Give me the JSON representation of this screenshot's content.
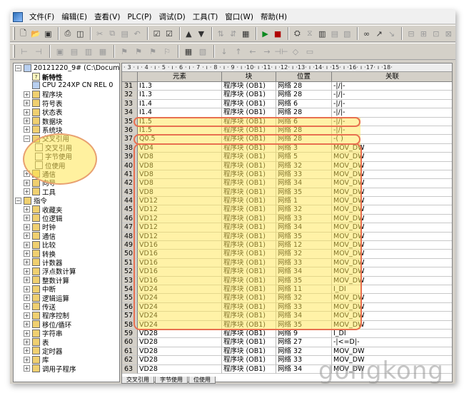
{
  "menu": [
    "文件(F)",
    "编辑(E)",
    "查看(V)",
    "PLC(P)",
    "调试(D)",
    "工具(T)",
    "窗口(W)",
    "帮助(H)"
  ],
  "tree": {
    "project": "20121220_9# (C:\\Docume",
    "items": [
      {
        "label": "新特性",
        "bold": true,
        "level": 1,
        "icon": "help"
      },
      {
        "label": "CPU 224XP CN REL 0",
        "level": 1,
        "icon": "cpu"
      },
      {
        "label": "程序块",
        "level": 1,
        "icon": "folder",
        "exp": "+"
      },
      {
        "label": "符号表",
        "level": 1,
        "icon": "folder",
        "exp": "+"
      },
      {
        "label": "状态表",
        "level": 1,
        "icon": "folder",
        "exp": "+"
      },
      {
        "label": "数据块",
        "level": 1,
        "icon": "folder",
        "exp": "+"
      },
      {
        "label": "系统块",
        "level": 1,
        "icon": "folder",
        "exp": "+"
      },
      {
        "label": "交叉引用",
        "level": 1,
        "icon": "folder",
        "exp": "-"
      },
      {
        "label": "交叉引用",
        "level": 2,
        "icon": "doc"
      },
      {
        "label": "字节使用",
        "level": 2,
        "icon": "doc"
      },
      {
        "label": "位使用",
        "level": 2,
        "icon": "doc"
      },
      {
        "label": "通信",
        "level": 1,
        "icon": "folder",
        "exp": "+"
      },
      {
        "label": "向导",
        "level": 1,
        "icon": "folder",
        "exp": "+"
      },
      {
        "label": "工具",
        "level": 1,
        "icon": "folder",
        "exp": "+"
      },
      {
        "label": "指令",
        "level": 0,
        "icon": "folder",
        "exp": "-"
      },
      {
        "label": "收藏夹",
        "level": 1,
        "icon": "folder",
        "exp": "+"
      },
      {
        "label": "位逻辑",
        "level": 1,
        "icon": "folder",
        "exp": "+"
      },
      {
        "label": "时钟",
        "level": 1,
        "icon": "folder",
        "exp": "+"
      },
      {
        "label": "通信",
        "level": 1,
        "icon": "folder",
        "exp": "+"
      },
      {
        "label": "比较",
        "level": 1,
        "icon": "folder",
        "exp": "+"
      },
      {
        "label": "转换",
        "level": 1,
        "icon": "folder",
        "exp": "+"
      },
      {
        "label": "计数器",
        "level": 1,
        "icon": "folder",
        "exp": "+"
      },
      {
        "label": "浮点数计算",
        "level": 1,
        "icon": "folder",
        "exp": "+"
      },
      {
        "label": "整数计算",
        "level": 1,
        "icon": "folder",
        "exp": "+"
      },
      {
        "label": "中断",
        "level": 1,
        "icon": "folder",
        "exp": "+"
      },
      {
        "label": "逻辑运算",
        "level": 1,
        "icon": "folder",
        "exp": "+"
      },
      {
        "label": "传送",
        "level": 1,
        "icon": "folder",
        "exp": "+"
      },
      {
        "label": "程序控制",
        "level": 1,
        "icon": "folder",
        "exp": "+"
      },
      {
        "label": "移位/循环",
        "level": 1,
        "icon": "folder",
        "exp": "+"
      },
      {
        "label": "字符串",
        "level": 1,
        "icon": "folder",
        "exp": "+"
      },
      {
        "label": "表",
        "level": 1,
        "icon": "folder",
        "exp": "+"
      },
      {
        "label": "定时器",
        "level": 1,
        "icon": "folder",
        "exp": "+"
      },
      {
        "label": "库",
        "level": 1,
        "icon": "folder",
        "exp": "+"
      },
      {
        "label": "调用子程序",
        "level": 1,
        "icon": "folder",
        "exp": "+"
      }
    ]
  },
  "ruler": "· 3 · ı · 4 · ı · 5 · ı · 6 · ı · 7 · ı · 8 · ı · 9 · ı ·10· ı ·11· ı ·12· ı ·13· ı ·14· ı ·15· ı ·16· ı ·17· ı ·18·",
  "columns": [
    "元素",
    "块",
    "位置",
    "关联"
  ],
  "rows": [
    [
      "31",
      "I1.3",
      "程序块 (OB1)",
      "网络 28",
      "-|/|-"
    ],
    [
      "32",
      "I1.3",
      "程序块 (OB1)",
      "网络 28",
      "-|/|-"
    ],
    [
      "33",
      "I1.4",
      "程序块 (OB1)",
      "网络 6",
      "-|/|-"
    ],
    [
      "34",
      "I1.4",
      "程序块 (OB1)",
      "网络 28",
      "-|/|-"
    ],
    [
      "35",
      "I1.5",
      "程序块 (OB1)",
      "网络 6",
      "-|/|-"
    ],
    [
      "36",
      "I1.5",
      "程序块 (OB1)",
      "网络 28",
      "-|/|-"
    ],
    [
      "37",
      "Q0.5",
      "程序块 (OB1)",
      "网络 28",
      "-( )"
    ],
    [
      "38",
      "VD4",
      "程序块 (OB1)",
      "网络 3",
      "MOV_DW"
    ],
    [
      "39",
      "VD8",
      "程序块 (OB1)",
      "网络 5",
      "MOV_DW"
    ],
    [
      "40",
      "VD8",
      "程序块 (OB1)",
      "网络 32",
      "MOV_DW"
    ],
    [
      "41",
      "VD8",
      "程序块 (OB1)",
      "网络 33",
      "MOV_DW"
    ],
    [
      "42",
      "VD8",
      "程序块 (OB1)",
      "网络 34",
      "MOV_DW"
    ],
    [
      "43",
      "VD8",
      "程序块 (OB1)",
      "网络 35",
      "MOV_DW"
    ],
    [
      "44",
      "VD12",
      "程序块 (OB1)",
      "网络 1",
      "MOV_DW"
    ],
    [
      "45",
      "VD12",
      "程序块 (OB1)",
      "网络 32",
      "MOV_DW"
    ],
    [
      "46",
      "VD12",
      "程序块 (OB1)",
      "网络 33",
      "MOV_DW"
    ],
    [
      "47",
      "VD12",
      "程序块 (OB1)",
      "网络 34",
      "MOV_DW"
    ],
    [
      "48",
      "VD12",
      "程序块 (OB1)",
      "网络 35",
      "MOV_DW"
    ],
    [
      "49",
      "VD16",
      "程序块 (OB1)",
      "网络 12",
      "MOV_DW"
    ],
    [
      "50",
      "VD16",
      "程序块 (OB1)",
      "网络 32",
      "MOV_DW"
    ],
    [
      "51",
      "VD16",
      "程序块 (OB1)",
      "网络 33",
      "MOV_DW"
    ],
    [
      "52",
      "VD16",
      "程序块 (OB1)",
      "网络 34",
      "MOV_DW"
    ],
    [
      "53",
      "VD16",
      "程序块 (OB1)",
      "网络 35",
      "MOV_DW"
    ],
    [
      "54",
      "VD24",
      "程序块 (OB1)",
      "网络 11",
      "I_DI"
    ],
    [
      "55",
      "VD24",
      "程序块 (OB1)",
      "网络 32",
      "MOV_DW"
    ],
    [
      "56",
      "VD24",
      "程序块 (OB1)",
      "网络 33",
      "MOV_DW"
    ],
    [
      "57",
      "VD24",
      "程序块 (OB1)",
      "网络 34",
      "MOV_DW"
    ],
    [
      "58",
      "VD24",
      "程序块 (OB1)",
      "网络 35",
      "MOV_DW"
    ],
    [
      "59",
      "VD28",
      "程序块 (OB1)",
      "网络 9",
      "I_DI"
    ],
    [
      "60",
      "VD28",
      "程序块 (OB1)",
      "网络 27",
      "-|<=D|-"
    ],
    [
      "61",
      "VD28",
      "程序块 (OB1)",
      "网络 32",
      "MOV_DW"
    ],
    [
      "62",
      "VD28",
      "程序块 (OB1)",
      "网络 33",
      "MOV_DW"
    ],
    [
      "63",
      "VD28",
      "程序块 (OB1)",
      "网络 34",
      "MOV_DW"
    ]
  ],
  "tabs": [
    "交叉引用",
    "字节使用",
    "位使用"
  ],
  "watermark": "gongkong",
  "colors": {
    "highlight": "#ffe650",
    "outline": "#e87050",
    "chrome": "#d4d0c8"
  }
}
